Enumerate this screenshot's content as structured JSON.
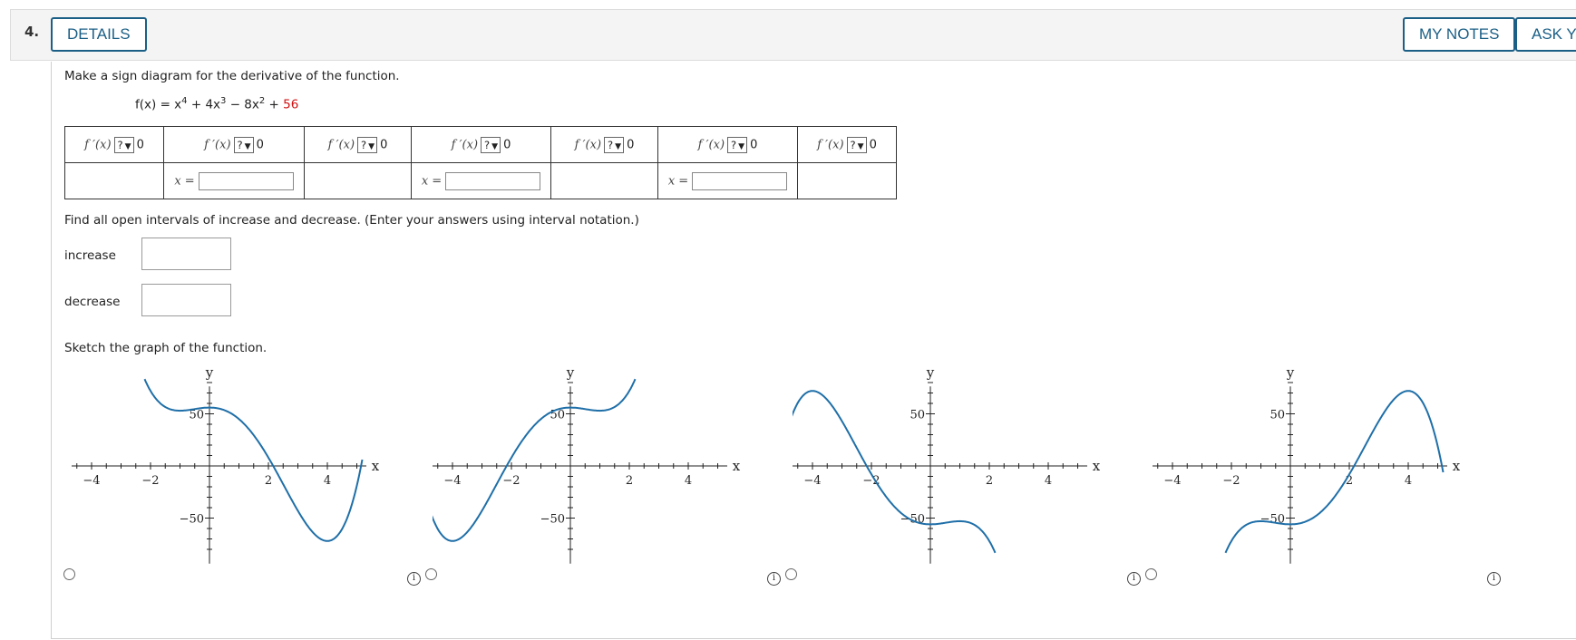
{
  "question": {
    "number": "4.",
    "details_label": "DETAILS",
    "my_notes_label": "MY NOTES",
    "ask_label": "ASK YC"
  },
  "instructions": {
    "sign_diagram": "Make a sign diagram for the derivative of the function.",
    "intervals": "Find all open intervals of increase and decrease. (Enter your answers using interval notation.)",
    "sketch": "Sketch the graph of the function."
  },
  "function": {
    "lhs": "f(x) = x",
    "exp4": "4",
    "term2": " + 4x",
    "exp3": "3",
    "term3": " − 8x",
    "exp2": "2",
    "plus": " + ",
    "constant": "56"
  },
  "sign_table": {
    "derivative_label": "f ′(x)",
    "select_value": "?",
    "zero": "0",
    "x_label": "x ="
  },
  "answers": {
    "increase_label": "increase",
    "decrease_label": "decrease"
  },
  "graphs": {
    "y_label": "y",
    "x_label": "x",
    "x_ticks": [
      "−4",
      "−2",
      "2",
      "4"
    ],
    "y_ticks": [
      "50",
      "−50"
    ],
    "curve_color": "#1f6fa8",
    "options": [
      "option-1",
      "option-2",
      "option-3",
      "option-4"
    ]
  },
  "icons": {
    "info": "info-icon",
    "radio": "radio-button",
    "dropdown": "chevron-down-icon"
  }
}
